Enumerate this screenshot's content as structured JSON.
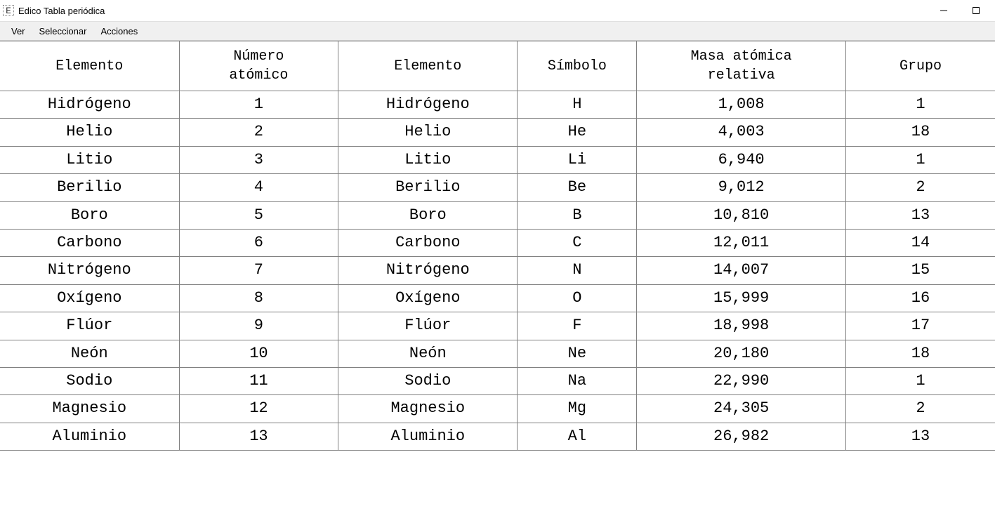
{
  "titlebar": {
    "icon_text": "E",
    "title": "Edico Tabla periódica"
  },
  "menubar": {
    "items": [
      "Ver",
      "Seleccionar",
      "Acciones"
    ]
  },
  "table": {
    "headers": [
      "Elemento",
      "Número\natómico",
      "Elemento",
      "Símbolo",
      "Masa atómica\nrelativa",
      "Grupo"
    ],
    "rows": [
      [
        "Hidrógeno",
        "1",
        "Hidrógeno",
        "H",
        "1,008",
        "1"
      ],
      [
        "Helio",
        "2",
        "Helio",
        "He",
        "4,003",
        "18"
      ],
      [
        "Litio",
        "3",
        "Litio",
        "Li",
        "6,940",
        "1"
      ],
      [
        "Berilio",
        "4",
        "Berilio",
        "Be",
        "9,012",
        "2"
      ],
      [
        "Boro",
        "5",
        "Boro",
        "B",
        "10,810",
        "13"
      ],
      [
        "Carbono",
        "6",
        "Carbono",
        "C",
        "12,011",
        "14"
      ],
      [
        "Nitrógeno",
        "7",
        "Nitrógeno",
        "N",
        "14,007",
        "15"
      ],
      [
        "Oxígeno",
        "8",
        "Oxígeno",
        "O",
        "15,999",
        "16"
      ],
      [
        "Flúor",
        "9",
        "Flúor",
        "F",
        "18,998",
        "17"
      ],
      [
        "Neón",
        "10",
        "Neón",
        "Ne",
        "20,180",
        "18"
      ],
      [
        "Sodio",
        "11",
        "Sodio",
        "Na",
        "22,990",
        "1"
      ],
      [
        "Magnesio",
        "12",
        "Magnesio",
        "Mg",
        "24,305",
        "2"
      ],
      [
        "Aluminio",
        "13",
        "Aluminio",
        "Al",
        "26,982",
        "13"
      ]
    ]
  }
}
